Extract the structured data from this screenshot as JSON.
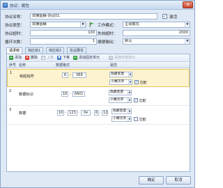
{
  "window": {
    "title": "协议：属性",
    "close_glyph": "✕"
  },
  "form": {
    "protocol_name_label": "协议名称：",
    "protocol_name_value": "双摘齿鲸-协议01",
    "enable_label": "激活",
    "enable_checked": "✓",
    "protocol_type_label": "协议类型：",
    "protocol_type_value": "双摘齿鲸",
    "work_mode_label": "工作模式：",
    "work_mode_value": "主动模式",
    "protocol_timeout_label": "协议超时：",
    "protocol_timeout_value": "100",
    "send_timeout_label": "失效超时：",
    "send_timeout_value": "2000",
    "retry_label": "循环次数：",
    "retry_value": "1",
    "mode_label": "顺便输出：",
    "mode_value": "默认"
  },
  "tabs": [
    {
      "label": "请求帧"
    },
    {
      "label": "响应帧1"
    },
    {
      "label": "响应帧2"
    },
    {
      "label": "协议脚本"
    }
  ],
  "toolbar": {
    "add": "添加",
    "delete": "删除",
    "up": "上移",
    "down": "下移",
    "add_fixed": "添加固定单元",
    "add_variable": "添加可变单元"
  },
  "grid": {
    "headers": {
      "seq": "序号",
      "name": "名称",
      "format": "数据格式",
      "attr": "属性"
    },
    "rows": [
      {
        "seq": "1",
        "name": "帧起始符",
        "fields": [
          "8",
          "0",
          "E8"
        ],
        "attr1": "隐藏变量",
        "attr2": "小端次序",
        "check_label": "匹配",
        "checked": "✓"
      },
      {
        "seq": "2",
        "name": "数据标识",
        "fields": [
          "16",
          "0A01"
        ],
        "attr1": "隐藏变量",
        "attr2": "小端次序",
        "check_label": "匹配",
        "checked": "✓"
      },
      {
        "seq": "3",
        "name": "数据",
        "fields": [
          "10",
          "123",
          "0",
          "6",
          "12"
        ],
        "attr1": "隐藏变量",
        "attr2": "小端次序",
        "check_label": "匹配",
        "checked": ""
      }
    ]
  },
  "footer": {
    "ok": "确定",
    "cancel": "取消"
  },
  "colors": {
    "accent": "#3a78c6",
    "selected_row": "#fdf3cf",
    "add_icon": "#2f9b3a",
    "delete_icon": "#d23b2a"
  },
  "icons": {
    "add": "add-icon",
    "delete": "delete-icon",
    "up": "arrow-up-icon",
    "down": "arrow-down-icon",
    "flag": "flag-icon",
    "close": "close-icon"
  }
}
